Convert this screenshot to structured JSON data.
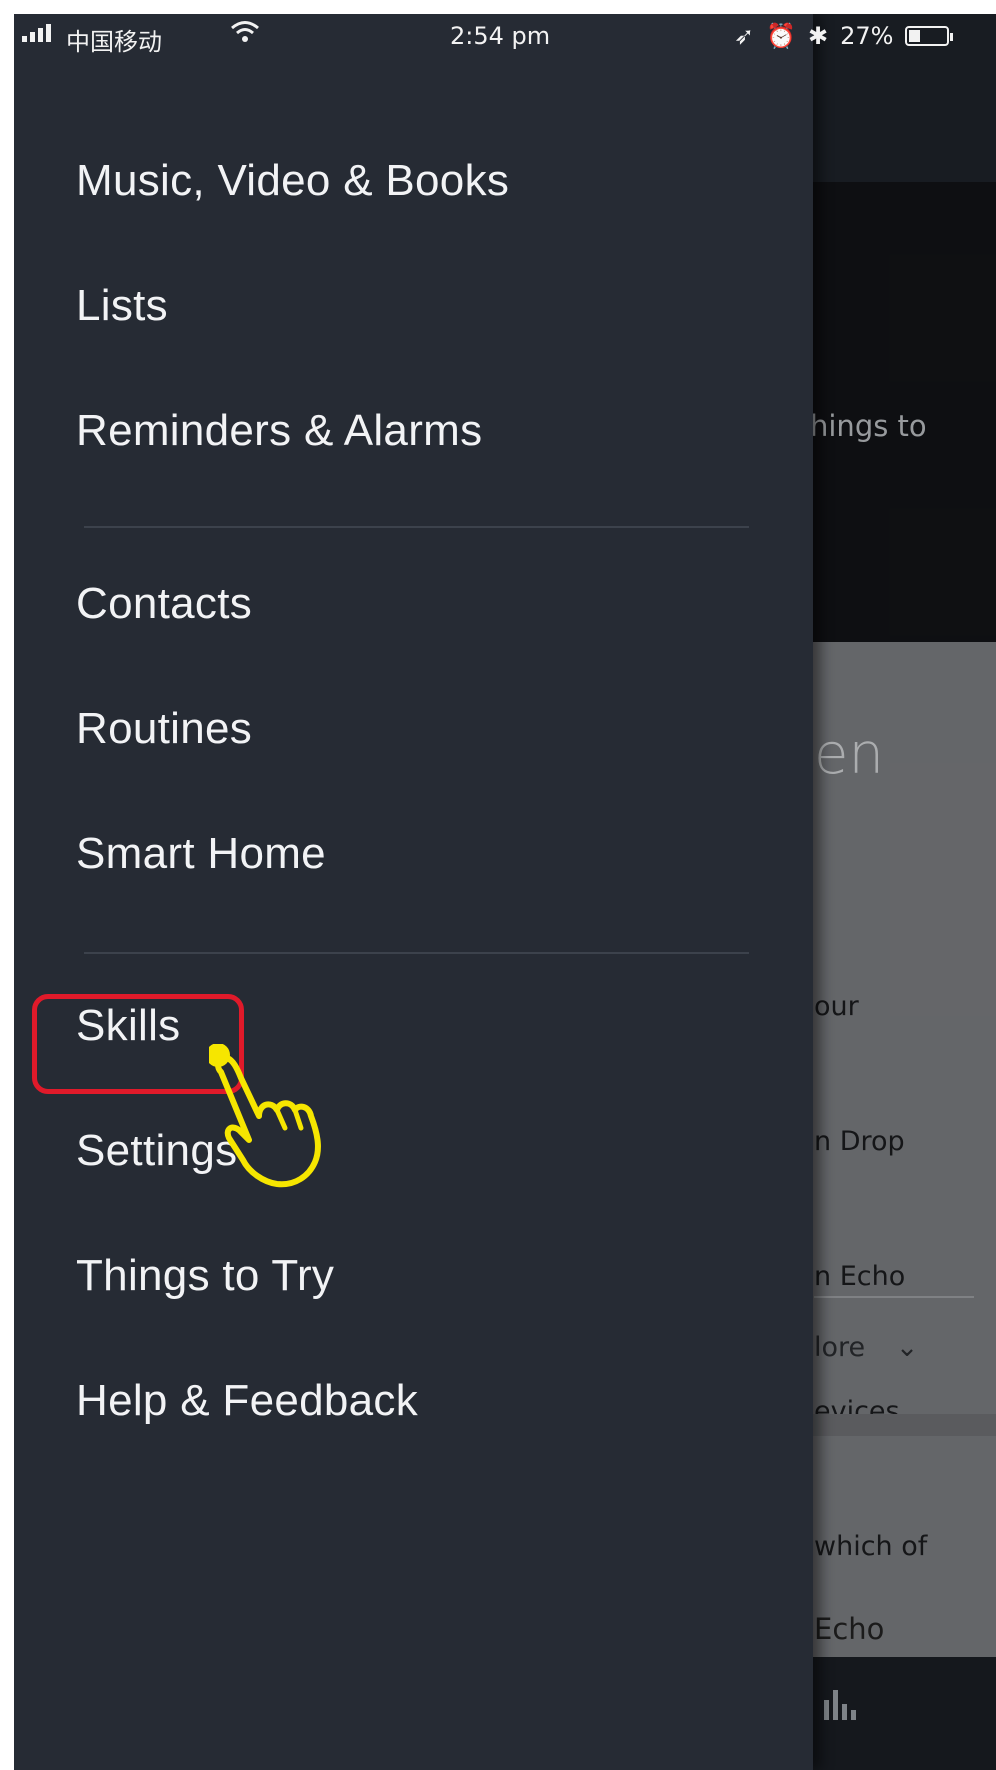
{
  "status_bar": {
    "carrier": "中国移动",
    "time": "2:54 pm",
    "battery": "27%",
    "battery_level": 0.27,
    "icons": [
      "signal-icon",
      "wifi-icon",
      "location-icon",
      "alarm-icon",
      "bluetooth-icon",
      "battery-icon"
    ]
  },
  "menu": {
    "items": [
      {
        "label": "Music, Video & Books"
      },
      {
        "label": "Lists"
      },
      {
        "label": "Reminders & Alarms"
      },
      {
        "label": "Contacts"
      },
      {
        "label": "Routines"
      },
      {
        "label": "Smart Home"
      },
      {
        "label": "Skills"
      },
      {
        "label": "Settings"
      },
      {
        "label": "Things to Try"
      },
      {
        "label": "Help & Feedback"
      }
    ],
    "highlighted": "Skills"
  },
  "background": {
    "hero_fragment": "hings to",
    "card_title_fragment": "en",
    "card_lines": [
      "our",
      "n Drop",
      "n Echo",
      "evices",
      "which of"
    ],
    "more_fragment": "lore",
    "echo_fragment": "Echo"
  },
  "colors": {
    "drawer": "#262b34",
    "highlight": "#e01a2a",
    "hand": "#f6e600"
  }
}
